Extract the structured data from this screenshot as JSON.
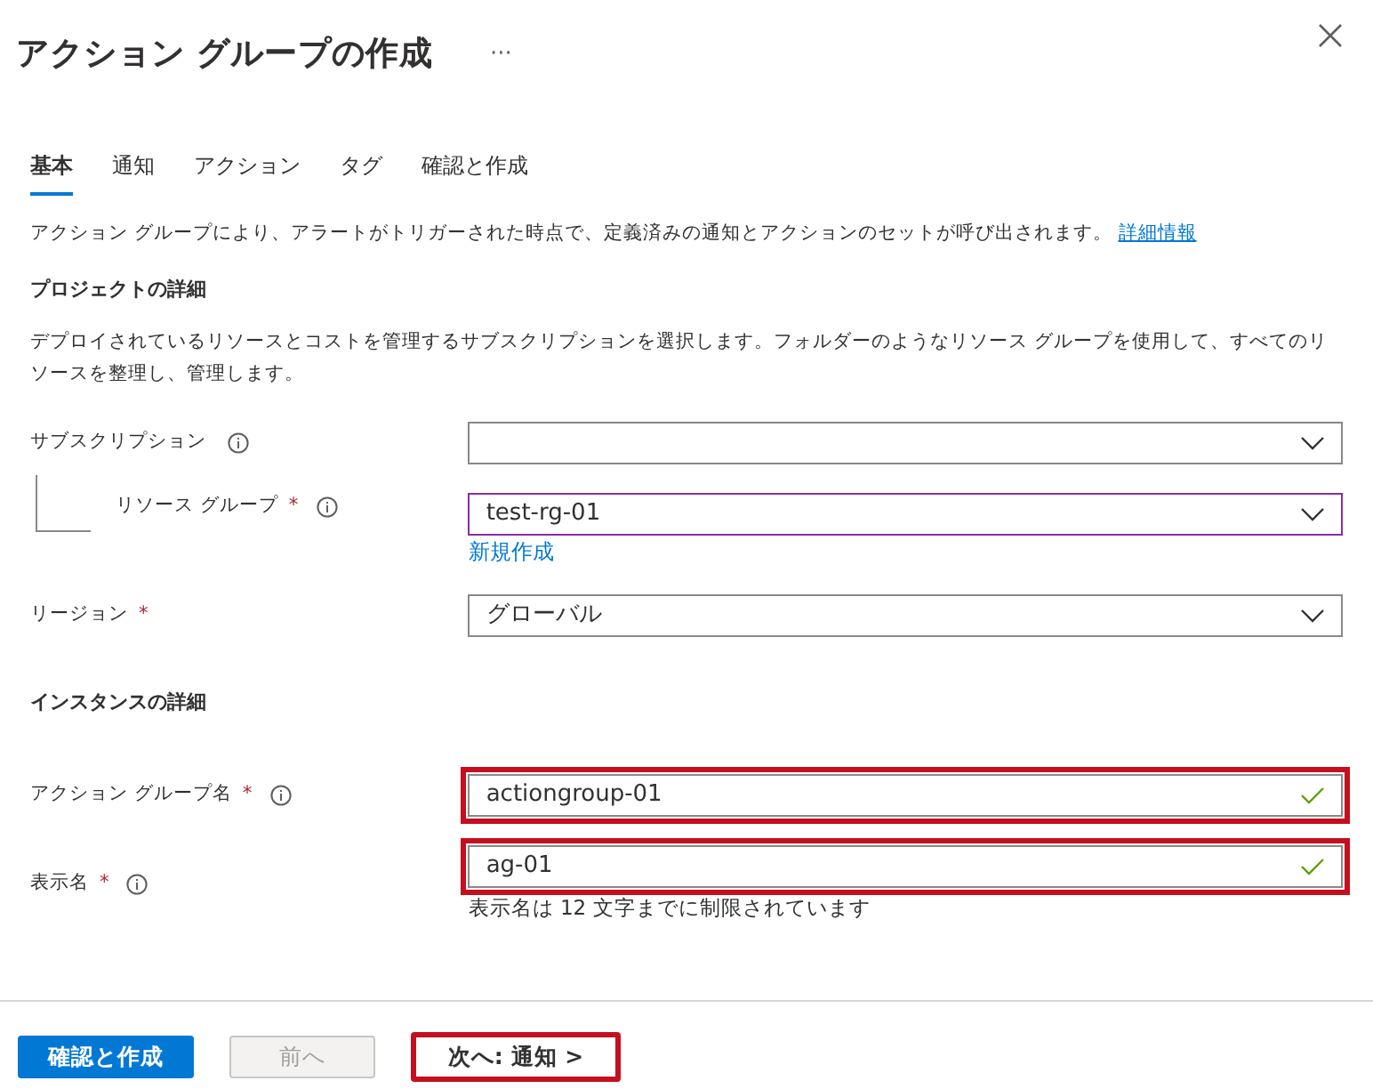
{
  "title": "アクション グループの作成",
  "more_menu": "···",
  "tabs": [
    {
      "label": "基本",
      "selected": true
    },
    {
      "label": "通知",
      "selected": false
    },
    {
      "label": "アクション",
      "selected": false
    },
    {
      "label": "タグ",
      "selected": false
    },
    {
      "label": "確認と作成",
      "selected": false
    }
  ],
  "intro": {
    "text": "アクション グループにより、アラートがトリガーされた時点で、定義済みの通知とアクションのセットが呼び出されます。",
    "link": "詳細情報"
  },
  "sections": [
    {
      "heading": "プロジェクトの詳細",
      "description": "デプロイされているリソースとコストを管理するサブスクリプションを選択します。フォルダーのようなリソース グループを使用して、すべてのリソースを整理し、管理します。",
      "fields": [
        {
          "kind": "dropdown",
          "label": "サブスクリプション",
          "info": true,
          "highlighted": false,
          "focused": false,
          "children": [
            {
              "kind": "dropdown",
              "label": "リソース グループ",
              "required_mark": "*",
              "info": true,
              "value": "test-rg-01",
              "highlighted": false,
              "focused": true,
              "link": "新規作成"
            }
          ]
        },
        {
          "kind": "dropdown",
          "label": "リージョン",
          "required_mark": "*",
          "info": false,
          "value": "グローバル",
          "highlighted": false,
          "focused": false
        }
      ]
    },
    {
      "heading": "インスタンスの詳細",
      "fields": [
        {
          "kind": "text",
          "label": "アクション グループ名",
          "required_mark": "*",
          "info": true,
          "value": "actiongroup-01",
          "valid": true,
          "highlighted": true,
          "focused": false
        },
        {
          "kind": "text",
          "label": "表示名",
          "required_mark": "*",
          "info": true,
          "value": "ag-01",
          "valid": true,
          "highlighted": true,
          "focused": false,
          "hint": "表示名は 12 文字までに制限されています"
        }
      ]
    }
  ],
  "buttons": [
    {
      "label": "確認と作成",
      "kind": "primary",
      "disabled": false,
      "highlighted": false
    },
    {
      "label": "前へ",
      "kind": "secondary",
      "disabled": true,
      "highlighted": false
    },
    {
      "label": "次へ: 通知 >",
      "kind": "secondary",
      "disabled": false,
      "highlighted": true
    }
  ]
}
